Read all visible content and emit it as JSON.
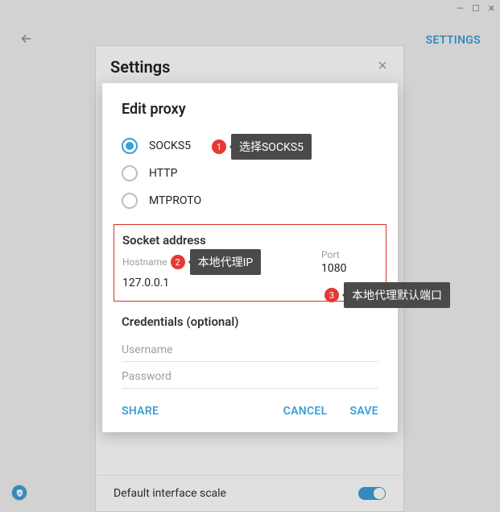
{
  "window": {
    "minimize": "—",
    "maximize": "☐",
    "close": "✕"
  },
  "topbar": {
    "settings_link": "SETTINGS"
  },
  "bg_panel": {
    "title": "Settings",
    "default_scale_label": "Default interface scale"
  },
  "dialog": {
    "title": "Edit proxy",
    "types": {
      "socks5": "SOCKS5",
      "http": "HTTP",
      "mtproto": "MTPROTO"
    },
    "socket_section": "Socket address",
    "hostname_label": "Hostname",
    "hostname_value": "127.0.0.1",
    "port_label": "Port",
    "port_value": "1080",
    "credentials_section": "Credentials (optional)",
    "username_placeholder": "Username",
    "password_placeholder": "Password",
    "share": "SHARE",
    "cancel": "CANCEL",
    "save": "SAVE"
  },
  "annotations": {
    "n1": "1",
    "tip1": "选择SOCKS5",
    "n2": "2",
    "tip2": "本地代理IP",
    "n3": "3",
    "tip3": "本地代理默认端口"
  }
}
